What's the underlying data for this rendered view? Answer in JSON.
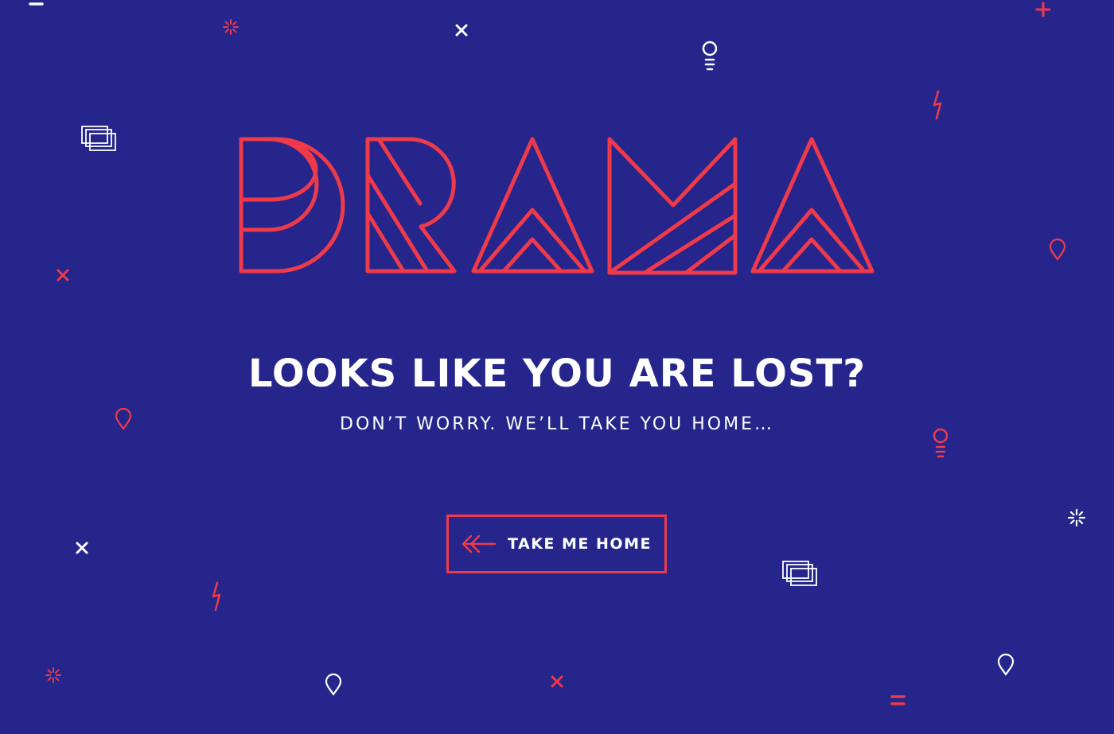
{
  "page": {
    "background_color": "#25258c",
    "accent_color": "#ef3a4a",
    "text_color": "#ffffff"
  },
  "logo": {
    "text": "DRAMA",
    "style": "red outlined geometric lettering"
  },
  "message": {
    "headline": "LOOKS LIKE YOU ARE LOST?",
    "subline": "DON’T WORRY. WE’LL TAKE YOU HOME…"
  },
  "home_button": {
    "label": "TAKE ME HOME",
    "icon": "double-arrow-left-icon"
  },
  "decorations": {
    "icon_types": [
      "close-x-icon",
      "sparkle-icon",
      "plus-icon",
      "lightbulb-icon",
      "lightning-icon",
      "stacked-windows-icon",
      "map-pin-icon",
      "equals-icon"
    ],
    "colors": [
      "#ef3a4a",
      "#ffffff"
    ]
  }
}
